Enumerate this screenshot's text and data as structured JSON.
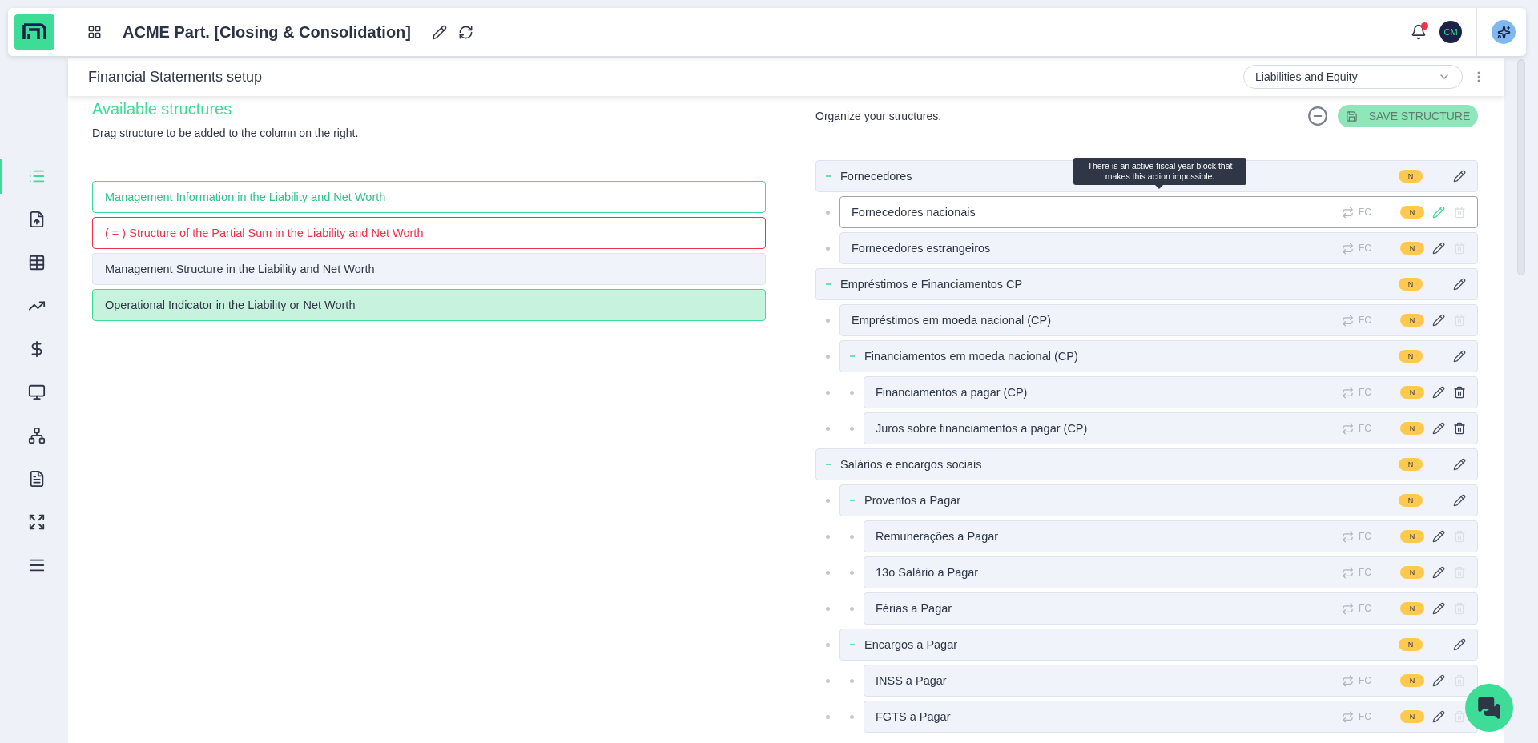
{
  "header": {
    "title": "ACME Part. [Closing & Consolidation]",
    "has_notification": true,
    "avatar": "CM"
  },
  "sidebar": {
    "items": [
      {
        "selected": true
      },
      {
        "selected": false
      },
      {
        "selected": false
      },
      {
        "selected": false
      },
      {
        "selected": false
      },
      {
        "selected": false
      },
      {
        "selected": false
      },
      {
        "selected": false
      },
      {
        "selected": false
      },
      {
        "selected": false
      }
    ]
  },
  "subheader": {
    "title": "Financial Statements setup",
    "statement": "Liabilities and Equity"
  },
  "available": {
    "heading": "Available structures",
    "hint": "Drag structure to be added to the column on the right.",
    "items": [
      {
        "kind": "info",
        "label": "Management Information in the Liability and Net Worth"
      },
      {
        "kind": "partial-sum",
        "label": "( = ) Structure of the Partial Sum in the Liability and Net Worth"
      },
      {
        "kind": "structure",
        "label": "Management Structure in the Liability and Net Worth"
      },
      {
        "kind": "indicator",
        "label": "Operational Indicator in the Liability or Net Worth"
      }
    ]
  },
  "organize": {
    "hint": "Organize your structures.",
    "save_button": {
      "label": "SAVE STRUCTURE",
      "disabled": true
    },
    "tooltip": {
      "text": "There is an active fiscal year block that makes this action impossible."
    },
    "tree": [
      {
        "kind": "group",
        "label": "Fornecedores",
        "badge": "N",
        "expanded": true,
        "selected": false,
        "children": [
          {
            "kind": "account",
            "label": "Fornecedores nacionais",
            "currency": "FC",
            "badge": "N",
            "selected": true,
            "delete_disabled": true
          },
          {
            "kind": "account",
            "label": "Fornecedores estrangeiros",
            "currency": "FC",
            "badge": "N",
            "selected": false,
            "delete_disabled": true
          }
        ]
      },
      {
        "kind": "group",
        "label": "Empréstimos e Financiamentos CP",
        "badge": "N",
        "expanded": true,
        "selected": false,
        "children": [
          {
            "kind": "account",
            "label": "Empréstimos em moeda nacional (CP)",
            "currency": "FC",
            "badge": "N",
            "selected": false,
            "delete_disabled": true
          },
          {
            "kind": "group",
            "label": "Financiamentos em moeda nacional (CP)",
            "badge": "N",
            "expanded": true,
            "selected": false,
            "children": [
              {
                "kind": "account",
                "label": "Financiamentos a pagar (CP)",
                "currency": "FC",
                "badge": "N",
                "selected": false,
                "delete_disabled": false
              },
              {
                "kind": "account",
                "label": "Juros sobre financiamentos a pagar (CP)",
                "currency": "FC",
                "badge": "N",
                "selected": false,
                "delete_disabled": false
              }
            ]
          }
        ]
      },
      {
        "kind": "group",
        "label": "Salários e encargos sociais",
        "badge": "N",
        "expanded": true,
        "selected": false,
        "children": [
          {
            "kind": "group",
            "label": "Proventos a Pagar",
            "badge": "N",
            "expanded": true,
            "selected": false,
            "children": [
              {
                "kind": "account",
                "label": "Remunerações a Pagar",
                "currency": "FC",
                "badge": "N",
                "selected": false,
                "delete_disabled": true
              },
              {
                "kind": "account",
                "label": "13o Salário a Pagar",
                "currency": "FC",
                "badge": "N",
                "selected": false,
                "delete_disabled": true
              },
              {
                "kind": "account",
                "label": "Férias a Pagar",
                "currency": "FC",
                "badge": "N",
                "selected": false,
                "delete_disabled": true
              }
            ]
          },
          {
            "kind": "group",
            "label": "Encargos a Pagar",
            "badge": "N",
            "expanded": true,
            "selected": false,
            "children": [
              {
                "kind": "account",
                "label": "INSS a Pagar",
                "currency": "FC",
                "badge": "N",
                "selected": false,
                "delete_disabled": true
              },
              {
                "kind": "account",
                "label": "FGTS a Pagar",
                "currency": "FC",
                "badge": "N",
                "selected": false,
                "delete_disabled": true
              }
            ]
          }
        ]
      }
    ]
  }
}
